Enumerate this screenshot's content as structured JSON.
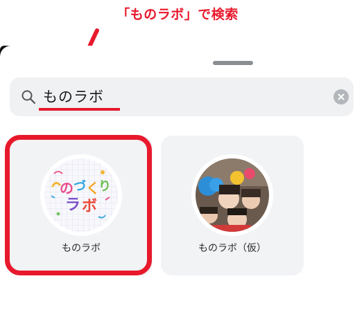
{
  "annotation": {
    "text": "「ものラボ」で検索",
    "color": "#e8192c"
  },
  "search": {
    "value": "ものラボ",
    "icon": "search-icon",
    "clear_icon": "clear-icon"
  },
  "results": [
    {
      "name": "ものラボ",
      "avatar": "monolabo-logo-avatar",
      "highlighted": true
    },
    {
      "name": "ものラボ（仮）",
      "avatar": "group-photo-avatar",
      "highlighted": false
    }
  ],
  "colors": {
    "highlight": "#e8192c",
    "card_bg": "#f1f3f5",
    "search_bg": "#eff1f3"
  }
}
